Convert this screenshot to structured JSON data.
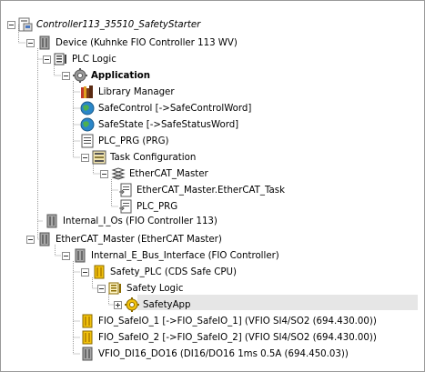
{
  "tree": {
    "controller": "Controller113_35510_SafetyStarter",
    "device": "Device (Kuhnke FIO Controller 113 WV)",
    "plc_logic": "PLC Logic",
    "application": "Application",
    "library_manager": "Library Manager",
    "safe_control": "SafeControl [->SafeControlWord]",
    "safe_state": "SafeState [->SafeStatusWord]",
    "plc_prg": "PLC_PRG (PRG)",
    "task_configuration": "Task Configuration",
    "ethercat_master_task_group": "EtherCAT_Master",
    "ethercat_task": "EtherCAT_Master.EtherCAT_Task",
    "plc_prg_task": "PLC_PRG",
    "internal_ios": "Internal_I_Os (FIO Controller 113)",
    "ethercat_master": "EtherCAT_Master (EtherCAT Master)",
    "internal_ebus": "Internal_E_Bus_Interface (FIO Controller)",
    "safety_plc": "Safety_PLC (CDS Safe CPU)",
    "safety_logic": "Safety Logic",
    "safety_app": "SafetyApp",
    "fio_safeio_1": "FIO_SafeIO_1 [->FIO_SafeIO_1] (VFIO SI4/SO2 (694.430.00))",
    "fio_safeio_2": "FIO_SafeIO_2 [->FIO_SafeIO_2] (VFIO SI4/SO2 (694.430.00))",
    "vfio_di16": "VFIO_DI16_DO16 (DI16/DO16 1ms 0.5A (694.450.03))"
  },
  "colors": {
    "selection": "#e6e6e6",
    "yellow_device": "#f2c20c",
    "gray_device": "#8a8a8a"
  },
  "icons": {
    "controller": "project-icon",
    "device": "device-icon",
    "plc_logic": "plc-logic-icon",
    "application": "application-gear-icon",
    "library": "library-books-icon",
    "globe": "globe-variable-icon",
    "pou": "pou-document-icon",
    "task_config": "task-configuration-icon",
    "task": "task-icon",
    "task_call": "task-call-icon",
    "safety_plc": "safety-plc-icon",
    "safety_app": "safety-app-gear-icon"
  }
}
